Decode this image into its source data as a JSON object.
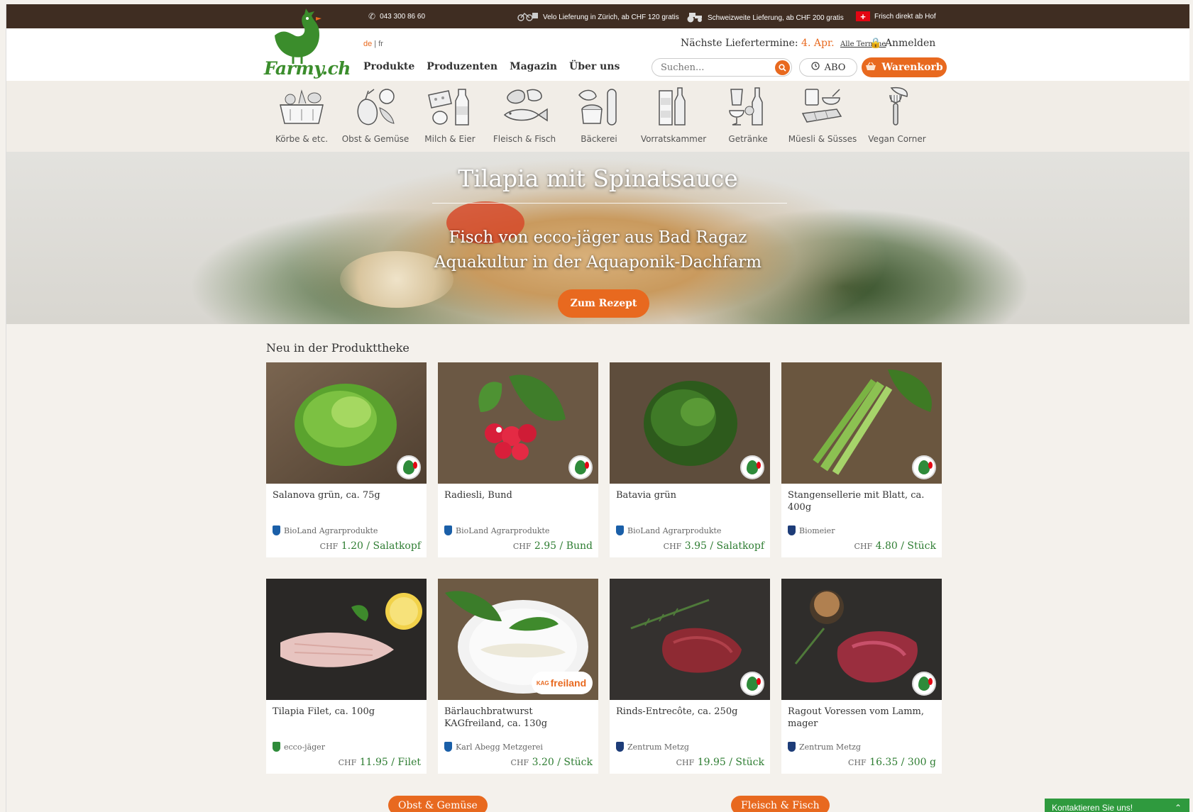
{
  "topbar": {
    "phone": "043 300 86 60",
    "velo": "Velo Lieferung in Zürich, ab CHF 120 gratis",
    "swiss": "Schweizweite Lieferung, ab CHF 200 gratis",
    "farm": "Frisch direkt ab Hof"
  },
  "header": {
    "logo_text": "Farmy.ch",
    "lang_de": "de",
    "lang_sep": " | ",
    "lang_fr": "fr",
    "nav": [
      "Produkte",
      "Produzenten",
      "Magazin",
      "Über uns"
    ],
    "delivery_label": "Nächste Liefertermine:",
    "delivery_date": "4. Apr.",
    "delivery_all": "Alle Termine",
    "login": "Anmelden",
    "search_placeholder": "Suchen...",
    "abo": "ABO",
    "cart": "Warenkorb"
  },
  "categories": [
    {
      "label": "Körbe & etc.",
      "icon": "basket-icon"
    },
    {
      "label": "Obst & Gemüse",
      "icon": "fruit-vegetable-icon"
    },
    {
      "label": "Milch & Eier",
      "icon": "milk-eggs-icon"
    },
    {
      "label": "Fleisch & Fisch",
      "icon": "meat-fish-icon"
    },
    {
      "label": "Bäckerei",
      "icon": "bakery-icon"
    },
    {
      "label": "Vorratskammer",
      "icon": "pantry-icon"
    },
    {
      "label": "Getränke",
      "icon": "drinks-icon"
    },
    {
      "label": "Müesli & Süsses",
      "icon": "muesli-sweets-icon"
    },
    {
      "label": "Vegan Corner",
      "icon": "vegan-icon"
    }
  ],
  "hero": {
    "title": "Tilapia mit Spinatsauce",
    "sub1": "Fisch von ecco-jäger aus Bad Ragaz",
    "sub2": "Aquakultur in der Aquaponik-Dachfarm",
    "button": "Zum Rezept"
  },
  "section_title": "Neu in der Produkttheke",
  "products": [
    {
      "name": "Salanova grün, ca. 75g",
      "producer": "BioLand Agrarprodukte",
      "currency": "CHF",
      "price": "1.20 / Salatkopf",
      "badge": "bio",
      "shield": "#1a5fa8"
    },
    {
      "name": "Radiesli, Bund",
      "producer": "BioLand Agrarprodukte",
      "currency": "CHF",
      "price": "2.95 / Bund",
      "badge": "bio",
      "shield": "#1a5fa8"
    },
    {
      "name": "Batavia grün",
      "producer": "BioLand Agrarprodukte",
      "currency": "CHF",
      "price": "3.95 / Salatkopf",
      "badge": "bio",
      "shield": "#1a5fa8"
    },
    {
      "name": "Stangensellerie mit Blatt, ca. 400g",
      "producer": "Biomeier",
      "currency": "CHF",
      "price": "4.80 / Stück",
      "badge": "bio",
      "shield": "#1d3c78"
    },
    {
      "name": "Tilapia Filet, ca. 100g",
      "producer": "ecco-jäger",
      "currency": "CHF",
      "price": "11.95 / Filet",
      "badge": "none",
      "shield": "#2e8b3a"
    },
    {
      "name": "Bärlauchbratwurst KAGfreiland, ca. 130g",
      "producer": "Karl Abegg Metzgerei",
      "currency": "CHF",
      "price": "3.20 / Stück",
      "badge": "kag",
      "shield": "#1a5fa8"
    },
    {
      "name": "Rinds-Entrecôte, ca. 250g",
      "producer": "Zentrum Metzg",
      "currency": "CHF",
      "price": "19.95 / Stück",
      "badge": "bio",
      "shield": "#1d3c78"
    },
    {
      "name": "Ragout Voressen vom Lamm, mager",
      "producer": "Zentrum Metzg",
      "currency": "CHF",
      "price": "16.35 / 300 g",
      "badge": "bio",
      "shield": "#1d3c78"
    }
  ],
  "kag_label": "freiland",
  "kag_prefix": "KAG",
  "footer_buttons": [
    "Obst & Gemüse",
    "Fleisch & Fisch"
  ],
  "contact": "Kontaktieren Sie uns!"
}
